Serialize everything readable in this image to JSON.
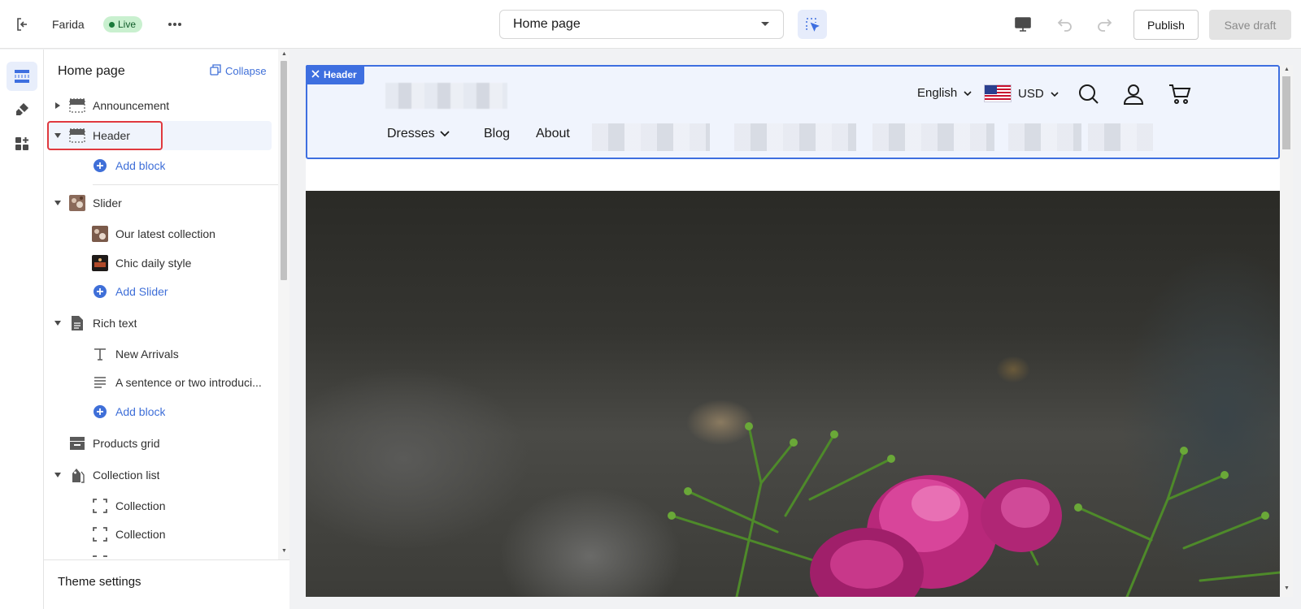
{
  "topbar": {
    "store_name": "Farida",
    "status_badge": "Live",
    "page_select_value": "Home page",
    "publish_label": "Publish",
    "save_draft_label": "Save draft",
    "icons": [
      "exit-icon",
      "more-icon",
      "chevron-down-icon",
      "inspect-icon",
      "desktop-icon",
      "undo-icon",
      "redo-icon"
    ]
  },
  "rail": {
    "items": [
      "sections-icon",
      "theme-brush-icon",
      "apps-icon"
    ],
    "active_index": 0
  },
  "sidebar": {
    "title": "Home page",
    "collapse_label": "Collapse",
    "tree": [
      {
        "label": "Announcement",
        "type": "section",
        "expanded": false,
        "icon": "section-layout-icon"
      },
      {
        "label": "Header",
        "type": "section",
        "expanded": true,
        "selected": true,
        "icon": "section-layout-icon"
      },
      {
        "label": "Add block",
        "type": "add"
      },
      {
        "label": "Slider",
        "type": "section",
        "expanded": true,
        "icon": "image-thumbnail"
      },
      {
        "label": "Our latest collection",
        "type": "block",
        "icon": "image-thumbnail"
      },
      {
        "label": "Chic daily style",
        "type": "block",
        "icon": "image-thumbnail"
      },
      {
        "label": "Add Slider",
        "type": "add"
      },
      {
        "label": "Rich text",
        "type": "section",
        "expanded": true,
        "icon": "document-icon"
      },
      {
        "label": "New Arrivals",
        "type": "block",
        "icon": "text-icon"
      },
      {
        "label": "A sentence or two introduci...",
        "type": "block",
        "icon": "paragraph-icon"
      },
      {
        "label": "Add block",
        "type": "add"
      },
      {
        "label": "Products grid",
        "type": "section",
        "icon": "products-grid-icon"
      },
      {
        "label": "Collection list",
        "type": "section",
        "expanded": true,
        "icon": "collection-tag-icon"
      },
      {
        "label": "Collection",
        "type": "block",
        "icon": "collection-frame-icon"
      },
      {
        "label": "Collection",
        "type": "block",
        "icon": "collection-frame-icon"
      }
    ],
    "footer_label": "Theme settings"
  },
  "preview": {
    "header_tag": "Header",
    "language": "English",
    "currency": "USD",
    "nav": [
      "Dresses",
      "Blog",
      "About"
    ],
    "icons": [
      "search-icon",
      "account-icon",
      "cart-icon"
    ],
    "accent_color": "#3e6fe0"
  },
  "colors": {
    "accent": "#3f6fd8",
    "highlight_outline": "#e0393e",
    "live_badge_bg": "#c9f0cf"
  }
}
